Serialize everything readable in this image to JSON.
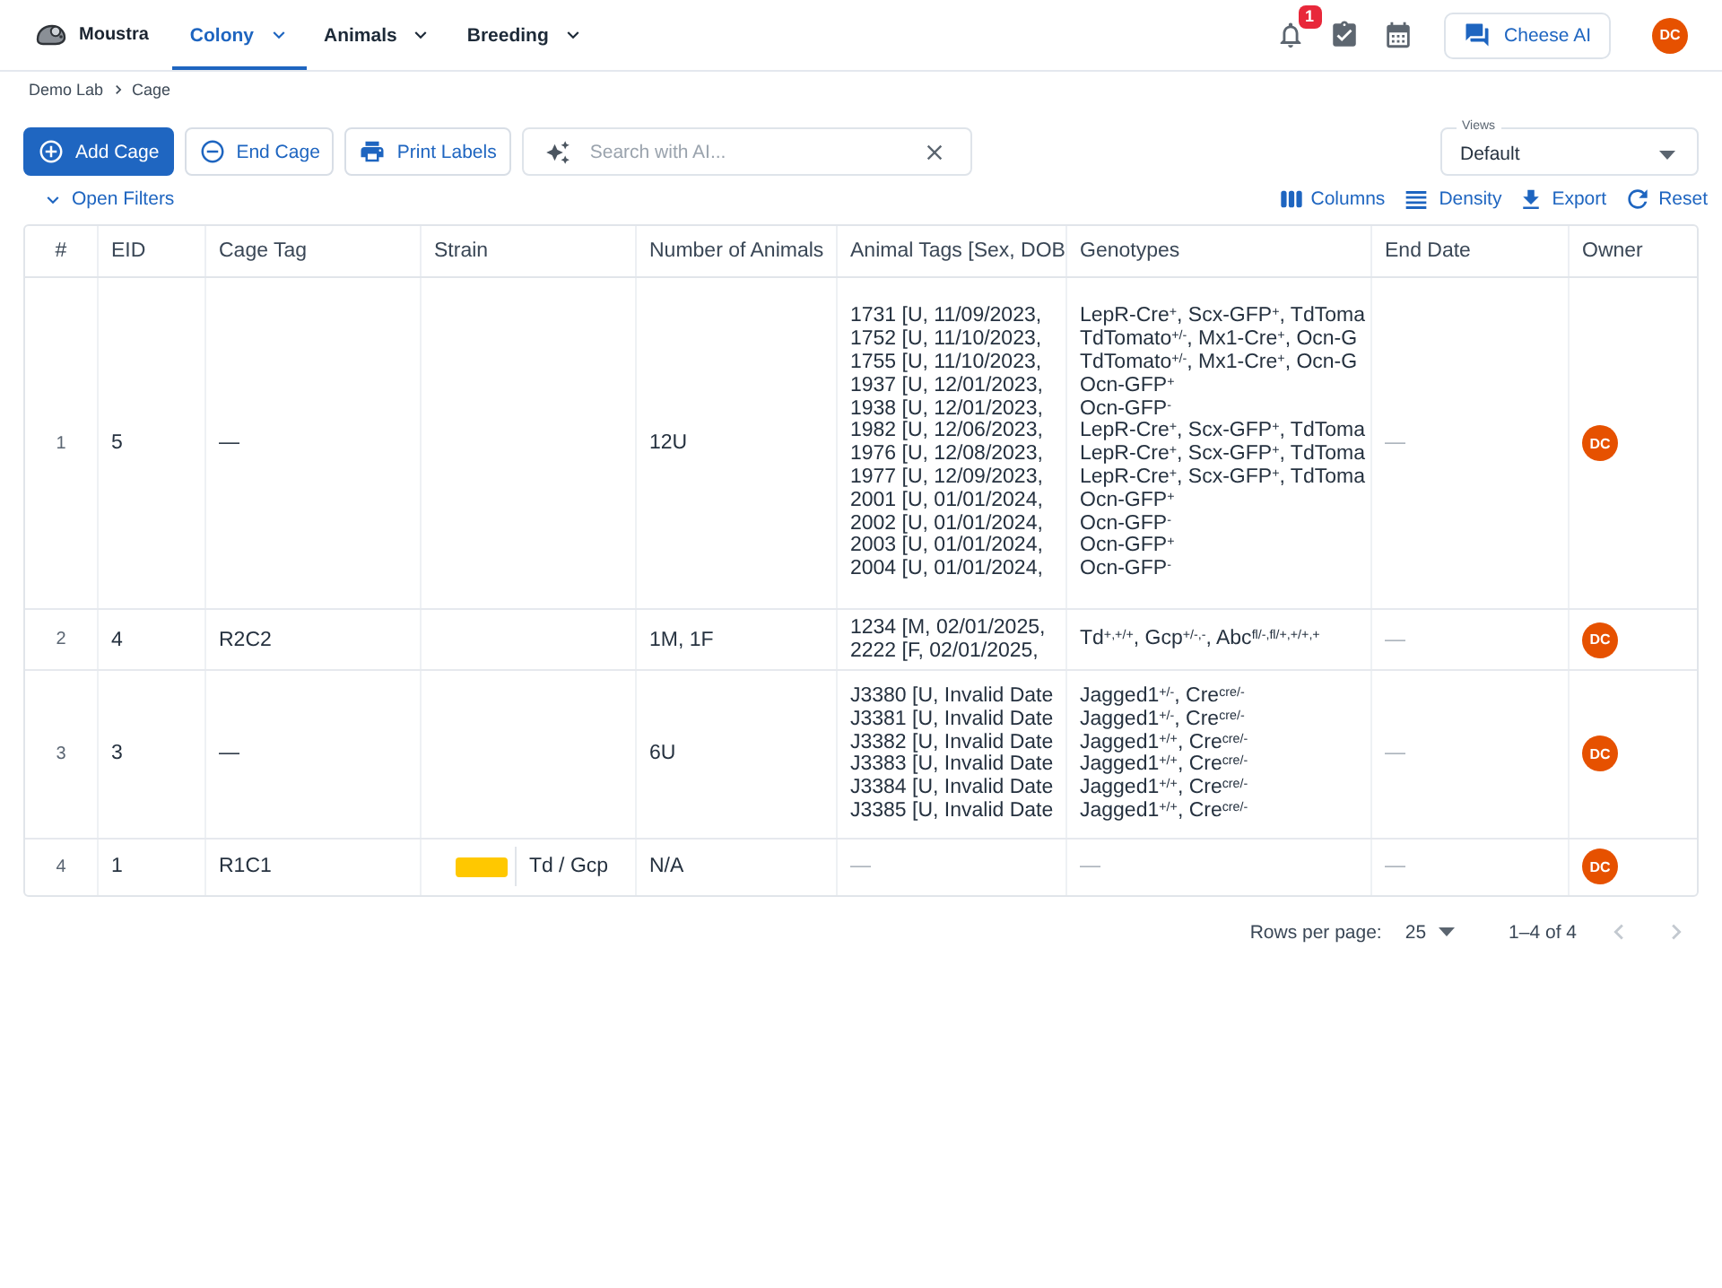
{
  "app": {
    "name": "Moustra"
  },
  "nav": [
    {
      "label": "Colony",
      "selected": true
    },
    {
      "label": "Animals",
      "selected": false
    },
    {
      "label": "Breeding",
      "selected": false
    }
  ],
  "header": {
    "notifications": "1",
    "assistant": "Cheese AI",
    "user_initials": "DC"
  },
  "breadcrumb": [
    "Demo Lab",
    "Cage"
  ],
  "toolbar": {
    "buttons": [
      {
        "label": "Add Cage",
        "kind": "primary"
      },
      {
        "label": "End Cage",
        "kind": "outlined"
      },
      {
        "label": "Print Labels",
        "kind": "outlined"
      }
    ],
    "search": {
      "placeholder": "Search with AI..."
    },
    "views": {
      "label": "Views",
      "value": "Default"
    }
  },
  "filters": {
    "toggle": "Open Filters",
    "actions": [
      "Columns",
      "Density",
      "Export",
      "Reset"
    ]
  },
  "table": {
    "columns": [
      "#",
      "EID",
      "Cage Tag",
      "Strain",
      "Number of Animals",
      "Animal Tags [Sex, DOB",
      "Genotypes",
      "End Date",
      "Owner"
    ],
    "rows": [
      {
        "index": "1",
        "eid": "5",
        "cage_tag": "—",
        "number_of_animals": "12U",
        "animal_tags": [
          "1731 [U, 11/09/2023,",
          "1752 [U, 11/10/2023,",
          "1755 [U, 11/10/2023,",
          "1937 [U, 12/01/2023,",
          "1938 [U, 12/01/2023,",
          "1982 [U, 12/06/2023,",
          "1976 [U, 12/08/2023,",
          "1977 [U, 12/09/2023,",
          "2001 [U, 01/01/2024,",
          "2002 [U, 01/01/2024,",
          "2003 [U, 01/01/2024,",
          "2004 [U, 01/01/2024,"
        ],
        "genotypes": [
          "LepR-Cre$^{+}$, Scx-GFP$^{+}$, TdToma",
          "TdTomato$^{+/-}$, Mx1-Cre$^{+}$, Ocn-G",
          "TdTomato$^{+/-}$, Mx1-Cre$^{+}$, Ocn-G",
          "Ocn-GFP$^{+}$",
          "Ocn-GFP$^{-}$",
          "LepR-Cre$^{+}$, Scx-GFP$^{+}$, TdToma",
          "LepR-Cre$^{+}$, Scx-GFP$^{+}$, TdToma",
          "LepR-Cre$^{+}$, Scx-GFP$^{+}$, TdToma",
          "Ocn-GFP$^{+}$",
          "Ocn-GFP$^{-}$",
          "Ocn-GFP$^{+}$",
          "Ocn-GFP$^{-}$"
        ],
        "end_date": "—",
        "owner": "DC"
      },
      {
        "index": "2",
        "eid": "4",
        "cage_tag": "R2C2",
        "number_of_animals": "1M, 1F",
        "animal_tags": [
          "1234 [M, 02/01/2025,",
          "2222 [F, 02/01/2025,"
        ],
        "genotypes": [
          "Td$^{+,+/+}$, Gcp$^{+/-,-}$, Abc$^{fl/-,fl/+,+/+,+}$"
        ],
        "end_date": "—",
        "owner": "DC"
      },
      {
        "index": "3",
        "eid": "3",
        "cage_tag": "—",
        "number_of_animals": "6U",
        "animal_tags": [
          "J3380 [U, Invalid Date",
          "J3381 [U, Invalid Date",
          "J3382 [U, Invalid Date",
          "J3383 [U, Invalid Date",
          "J3384 [U, Invalid Date",
          "J3385 [U, Invalid Date"
        ],
        "genotypes": [
          "Jagged1$^{+/-}$, Cre$^{cre/-}$",
          "Jagged1$^{+/-}$, Cre$^{cre/-}$",
          "Jagged1$^{+/+}$, Cre$^{cre/-}$",
          "Jagged1$^{+/+}$, Cre$^{cre/-}$",
          "Jagged1$^{+/+}$, Cre$^{cre/-}$",
          "Jagged1$^{+/+}$, Cre$^{cre/-}$"
        ],
        "end_date": "—",
        "owner": "DC"
      },
      {
        "index": "4",
        "eid": "1",
        "cage_tag": "R1C1",
        "strain": {
          "color": "#ffc800",
          "name": "Td / Gcp"
        },
        "number_of_animals": "N/A",
        "animal_tags": "—",
        "genotypes": "—",
        "end_date": "—",
        "owner": "DC"
      }
    ]
  },
  "pagination": {
    "rows_per_page_label": "Rows per page:",
    "rows_per_page": "25",
    "range": "1–4 of 4",
    "previous": {
      "disabled": true
    },
    "next": {
      "disabled": true
    }
  }
}
